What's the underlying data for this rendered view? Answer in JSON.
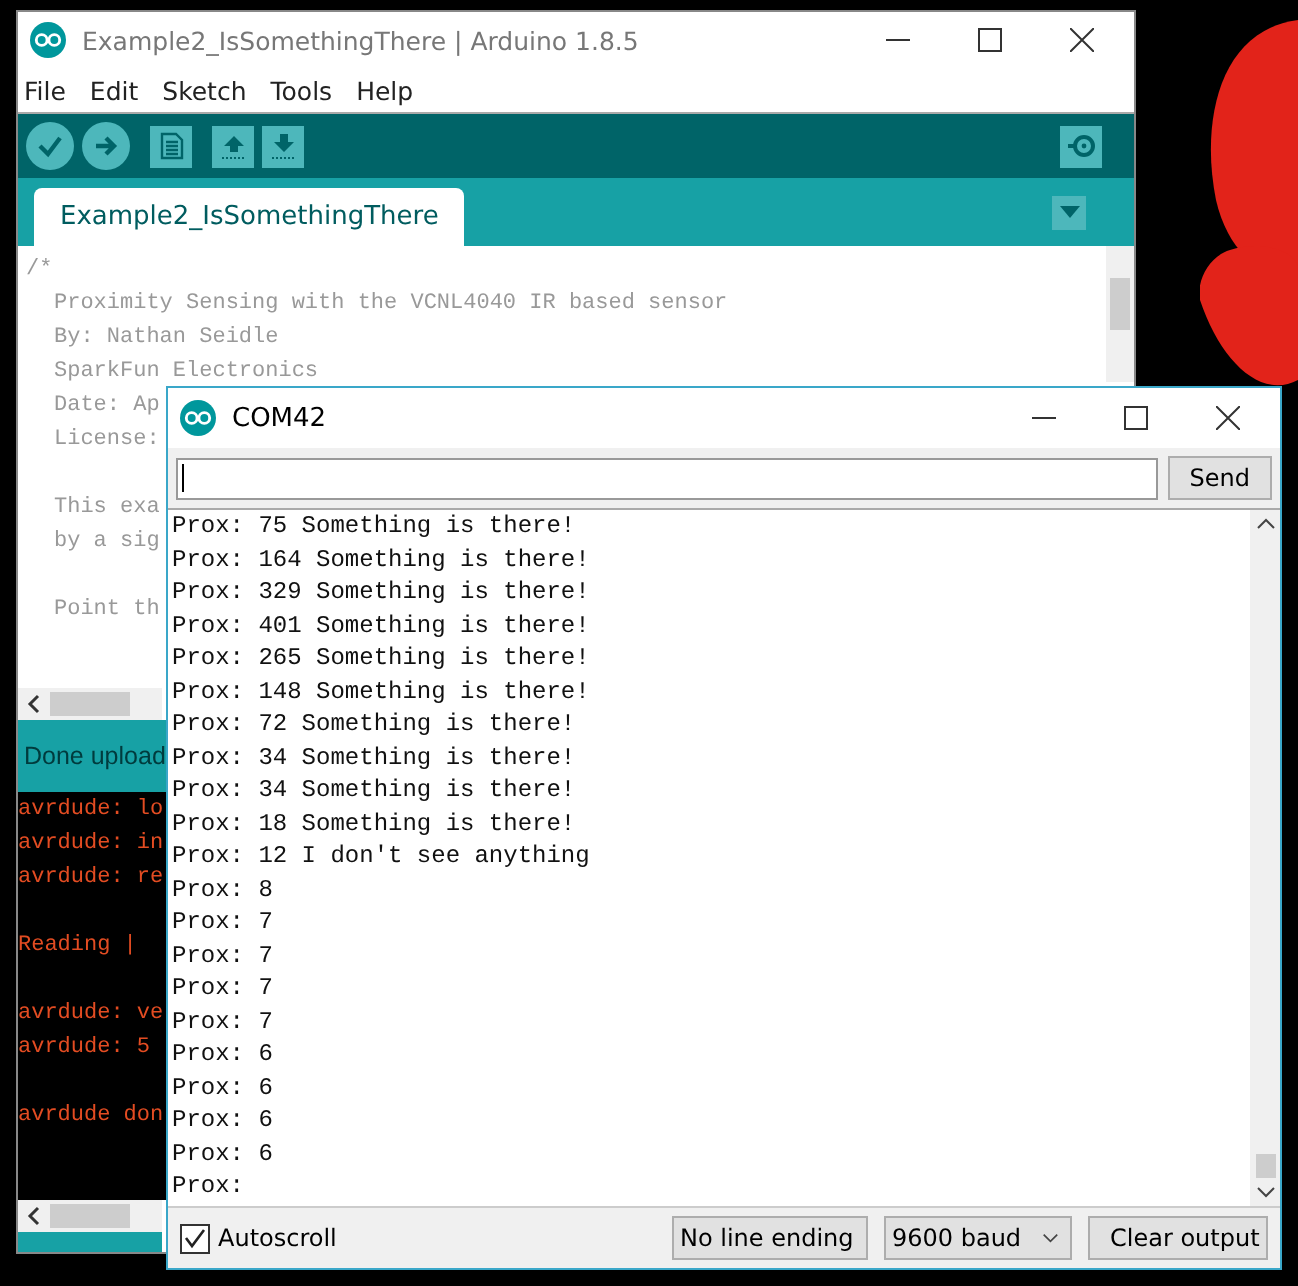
{
  "ide_window": {
    "title": "Example2_IsSomethingThere | Arduino 1.8.5",
    "menu": [
      "File",
      "Edit",
      "Sketch",
      "Tools",
      "Help"
    ],
    "tabs": [
      {
        "label": "Example2_IsSomethingThere",
        "selected": true
      }
    ],
    "editor": {
      "comment_open": "/*",
      "blocks": [
        [
          "Proximity Sensing with the VCNL4040 IR based sensor",
          "By: Nathan Seidle",
          "SparkFun Electronics",
          "Date: Ap",
          "License:"
        ],
        [
          "This exa",
          "by a sig"
        ],
        [
          "Point th"
        ]
      ]
    },
    "status": "Done upload",
    "console_blocks": [
      [
        "avrdude: lo",
        "avrdude: in",
        "avrdude: re"
      ],
      [
        "Reading |"
      ],
      [
        "avrdude: ve",
        "avrdude: 5"
      ],
      [
        "avrdude don"
      ]
    ]
  },
  "serial_monitor": {
    "title": "COM42",
    "send_button": "Send",
    "output_lines": [
      "Prox: 75 Something is there!",
      "Prox: 164 Something is there!",
      "Prox: 329 Something is there!",
      "Prox: 401 Something is there!",
      "Prox: 265 Something is there!",
      "Prox: 148 Something is there!",
      "Prox: 72 Something is there!",
      "Prox: 34 Something is there!",
      "Prox: 34 Something is there!",
      "Prox: 18 Something is there!",
      "Prox: 12 I don't see anything",
      "Prox: 8",
      "Prox: 7",
      "Prox: 7",
      "Prox: 7",
      "Prox: 7",
      "Prox: 6",
      "Prox: 6",
      "Prox: 6",
      "Prox: 6",
      "Prox:"
    ],
    "autoscroll": {
      "label": "Autoscroll",
      "checked": true
    },
    "line_ending": "No line ending",
    "baud": "9600 baud",
    "clear_button": "Clear output"
  }
}
